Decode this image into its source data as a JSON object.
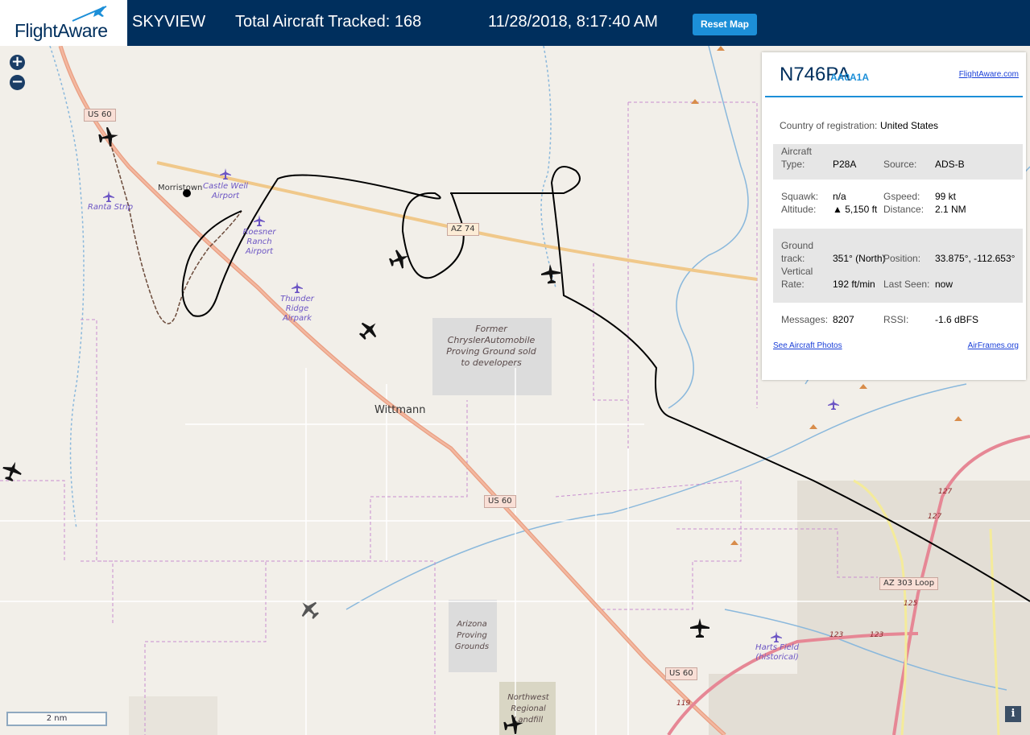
{
  "header": {
    "logo_text": "FlightAware",
    "brand": "SKYVIEW",
    "total_label": "Total Aircraft Tracked: 168",
    "datetime": "11/28/2018, 8:17:40 AM",
    "reset_label": "Reset Map"
  },
  "colors": {
    "header_bg": "#002f5d",
    "accent": "#1c8fd8",
    "track": "#000000"
  },
  "panel": {
    "registration": "N746PA",
    "hex": "AA0A1A",
    "flightaware_link": "FlightAware.com",
    "country_label": "Country of registration:",
    "country_value": "United States",
    "aircraft_type_label_1": "Aircraft",
    "aircraft_type_label_2": "Type:",
    "aircraft_type_value": "P28A",
    "source_label": "Source:",
    "source_value": "ADS-B",
    "squawk_label": "Squawk:",
    "squawk_value": "n/a",
    "gspeed_label": "Gspeed:",
    "gspeed_value": "99 kt",
    "altitude_label": "Altitude:",
    "altitude_value": "▲ 5,150 ft",
    "distance_label": "Distance:",
    "distance_value": "2.1 NM",
    "ground_track_label_1": "Ground",
    "ground_track_label_2": "track:",
    "ground_track_value": "351° (North)",
    "position_label": "Position:",
    "position_value": "33.875°, -112.653°",
    "vertical_label_1": "Vertical",
    "vertical_label_2": "Rate:",
    "vertical_value": "192 ft/min",
    "last_seen_label": "Last Seen:",
    "last_seen_value": "now",
    "messages_label": "Messages:",
    "messages_value": "8207",
    "rssi_label": "RSSI:",
    "rssi_value": "-1.6 dBFS",
    "photos_link": "See Aircraft Photos",
    "airframes_link": "AirFrames.org"
  },
  "map": {
    "zoom_in": "+",
    "zoom_out": "−",
    "scale": "2 nm",
    "info": "i",
    "towns": {
      "morristown": "Morristown",
      "wittmann": "Wittmann"
    },
    "airports": {
      "castle_well": "Castle Well Airport",
      "ranta": "Ranta Strip",
      "roesner": "Roesner Ranch Airport",
      "thunder": "Thunder Ridge Airpark",
      "harts": "Harts Field (historical)"
    },
    "areas": {
      "chrysler": "Former ChryslerAutomobile Proving Ground sold to developers",
      "arizona": "Arizona Proving Grounds",
      "landfill": "Northwest Regional Landfill"
    },
    "roads": {
      "us60_a": "US 60",
      "us60_b": "US 60",
      "us60_c": "US 60",
      "az74": "AZ 74",
      "az303": "AZ 303 Loop"
    },
    "miles": {
      "m127a": "127",
      "m127b": "127",
      "m125": "125",
      "m123a": "123",
      "m123b": "123",
      "m119": "119"
    }
  }
}
